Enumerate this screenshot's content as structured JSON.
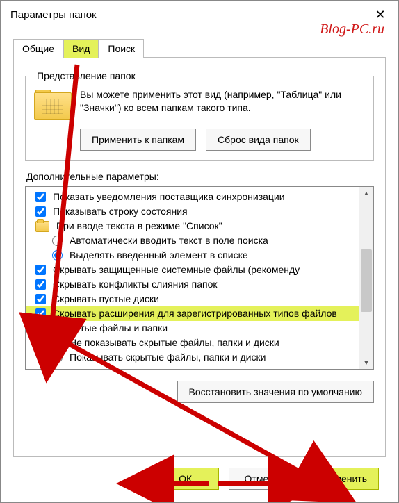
{
  "window": {
    "title": "Параметры папок",
    "close": "✕"
  },
  "watermark": "Blog-PC.ru",
  "tabs": {
    "general": "Общие",
    "view": "Вид",
    "search": "Поиск"
  },
  "folderRep": {
    "legend": "Представление папок",
    "text": "Вы можете применить этот вид (например, \"Таблица\" или \"Значки\") ко всем папкам такого типа.",
    "applyBtn": "Применить к папкам",
    "resetBtn": "Сброс вида папок"
  },
  "advanced": {
    "label": "Дополнительные параметры:",
    "items": {
      "i0": "Показать уведомления поставщика синхронизации",
      "i1": "Показывать строку состояния",
      "i2": "При вводе текста в режиме \"Список\"",
      "i3": "Автоматически вводить текст в поле поиска",
      "i4": "Выделять введенный элемент в списке",
      "i5": "Скрывать защищенные системные файлы (рекоменду",
      "i6": "Скрывать конфликты слияния папок",
      "i7": "Скрывать пустые диски",
      "i8": "Скрывать расширения для зарегистрированных типов файлов",
      "i9": "Скрытые файлы и папки",
      "i10": "Не показывать скрытые файлы, папки и диски",
      "i11": "Показывать скрытые файлы, папки и диски"
    },
    "restore": "Восстановить значения по умолчанию"
  },
  "buttons": {
    "ok": "ОК",
    "cancel": "Отмена",
    "apply": "Применить"
  }
}
